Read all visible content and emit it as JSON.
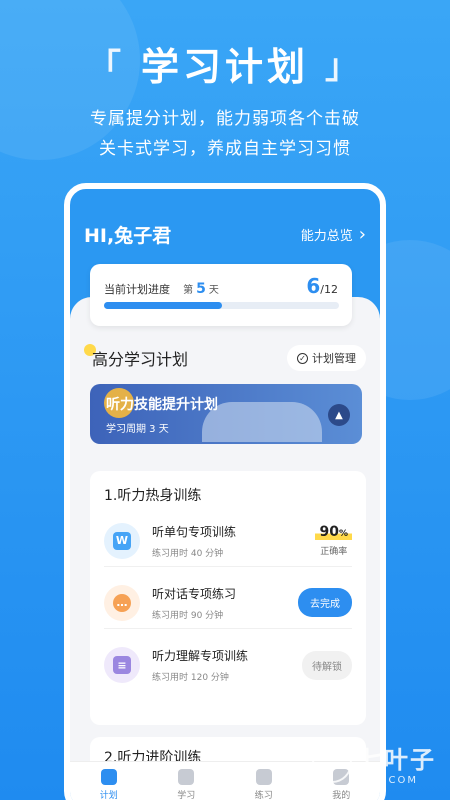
{
  "hero": {
    "title": "学习计划",
    "bracket_left": "「",
    "bracket_right": "」",
    "line1": "专属提分计划，能力弱项各个击破",
    "line2": "关卡式学习，养成自主学习习惯"
  },
  "header": {
    "greeting": "HI,兔子君",
    "overview_label": "能力总览",
    "overview_chevron": "›"
  },
  "progress": {
    "label": "当前计划进度",
    "day_prefix": "第",
    "day_value": "5",
    "day_suffix": "天",
    "current": "6",
    "total": "/12",
    "fraction": 0.5
  },
  "plan_section": {
    "title": "高分学习计划",
    "manage_label": "计划管理",
    "manage_icon": "check-circle-icon"
  },
  "banner": {
    "title": "听力技能提升计划",
    "subtitle": "学习周期 3 天"
  },
  "list": {
    "title": "1.听力热身训练",
    "items": [
      {
        "title": "听单句专项训练",
        "sub": "练习用时 40 分钟",
        "score": "90",
        "score_unit": "%",
        "score_label": "正确率"
      },
      {
        "title": "听对话专项练习",
        "sub": "练习用时 90 分钟",
        "action": "去完成"
      },
      {
        "title": "听力理解专项训练",
        "sub": "练习用时 120 分钟",
        "action": "待解锁"
      }
    ]
  },
  "next_section": {
    "title": "2.听力进阶训练"
  },
  "tabs": [
    {
      "label": "计划",
      "active": true
    },
    {
      "label": "学习",
      "active": false
    },
    {
      "label": "练习",
      "active": false
    },
    {
      "label": "我的",
      "active": false
    }
  ],
  "watermark": {
    "name": "七叶子",
    "url": "7YZ.COM"
  }
}
